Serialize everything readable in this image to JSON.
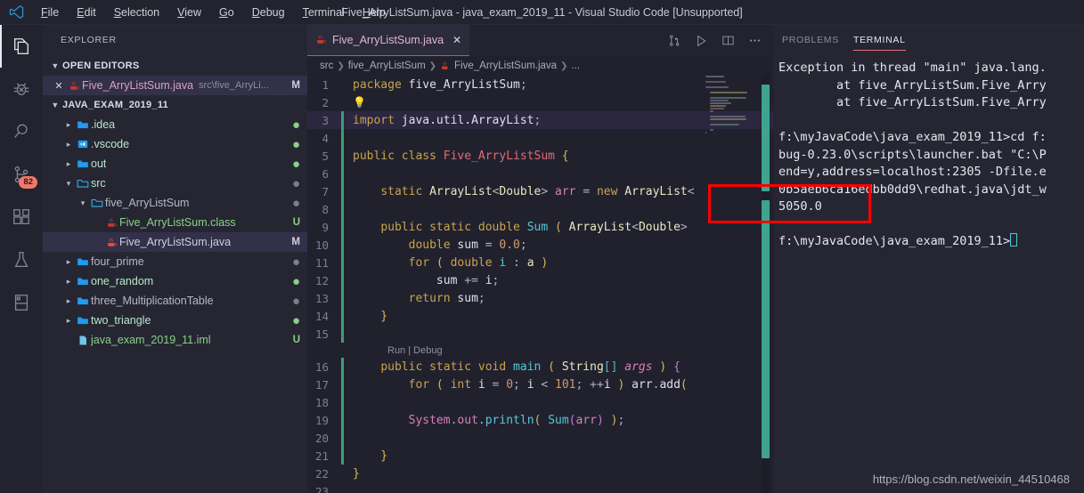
{
  "window": {
    "title": "Five_ArryListSum.java - java_exam_2019_11 - Visual Studio Code [Unsupported]",
    "logo_icon": "vscode-logo-icon"
  },
  "menubar": {
    "items": [
      {
        "label": "File"
      },
      {
        "label": "Edit"
      },
      {
        "label": "Selection"
      },
      {
        "label": "View"
      },
      {
        "label": "Go"
      },
      {
        "label": "Debug"
      },
      {
        "label": "Terminal"
      },
      {
        "label": "Help"
      }
    ]
  },
  "activitybar": {
    "items": [
      {
        "icon": "files-explorer-icon",
        "name": "explorer",
        "active": true,
        "badge": ""
      },
      {
        "icon": "debug-bug-icon",
        "name": "debug",
        "active": false,
        "badge": ""
      },
      {
        "icon": "search-icon",
        "name": "search",
        "active": false,
        "badge": ""
      },
      {
        "icon": "source-control-branch-icon",
        "name": "source-control",
        "active": false,
        "badge": "82"
      },
      {
        "icon": "extensions-blocks-icon",
        "name": "extensions",
        "active": false,
        "badge": ""
      },
      {
        "icon": "testing-flask-icon",
        "name": "testing",
        "active": false,
        "badge": ""
      },
      {
        "icon": "layout-panel-icon",
        "name": "layout",
        "active": false,
        "badge": ""
      }
    ]
  },
  "sidebar": {
    "title": "EXPLORER",
    "open_editors": {
      "label": "OPEN EDITORS",
      "items": [
        {
          "close_icon": "close-icon",
          "file_icon": "java-coffee-icon",
          "label": "Five_ArryListSum.java",
          "path": "src\\five_ArryLi...",
          "status": "M"
        }
      ]
    },
    "project": {
      "label": "JAVA_EXAM_2019_11",
      "tree": [
        {
          "arrow": "›",
          "icon": "folder-icon",
          "icon_color": "#1f9cf0",
          "label": ".idea",
          "indent": 1,
          "decor": "●",
          "decor_color": "#89d185",
          "label_color": "#b7e7c9"
        },
        {
          "arrow": "›",
          "icon": "vscode-folder-icon",
          "icon_color": "#1f9cf0",
          "label": ".vscode",
          "indent": 1,
          "decor": "●",
          "decor_color": "#89d185",
          "label_color": "#b7e7c9"
        },
        {
          "arrow": "›",
          "icon": "folder-icon",
          "icon_color": "#1f9cf0",
          "label": "out",
          "indent": 1,
          "decor": "●",
          "decor_color": "#89d185",
          "label_color": "#b7e7c9"
        },
        {
          "arrow": "∨",
          "icon": "folder-open-icon",
          "icon_color": "#2bb6f0",
          "label": "src",
          "indent": 1,
          "decor": "●",
          "decor_color": "#7d7d8d",
          "label_color": "#b7e7c9"
        },
        {
          "arrow": "∨",
          "icon": "folder-open-icon",
          "icon_color": "#2bb6f0",
          "label": "five_ArryListSum",
          "indent": 2,
          "decor": "●",
          "decor_color": "#7d7d8d",
          "label_color": "#b7b7c6"
        },
        {
          "arrow": "",
          "icon": "java-coffee-icon",
          "icon_color": "#c0392b",
          "label": "Five_ArryListSum.class",
          "indent": 3,
          "git": "U",
          "git_color": "#89d185",
          "label_color": "#89d185"
        },
        {
          "arrow": "",
          "icon": "java-coffee-icon",
          "icon_color": "#e74c3c",
          "label": "Five_ArryListSum.java",
          "indent": 3,
          "git": "M",
          "git_color": "#cfcfdb",
          "label_color": "#cfcfdb",
          "selected": true
        },
        {
          "arrow": "›",
          "icon": "folder-icon",
          "icon_color": "#1f9cf0",
          "label": "four_prime",
          "indent": 1,
          "decor": "●",
          "decor_color": "#7d7d8d",
          "label_color": "#b7b7c6"
        },
        {
          "arrow": "›",
          "icon": "folder-icon",
          "icon_color": "#1f9cf0",
          "label": "one_random",
          "indent": 1,
          "decor": "●",
          "decor_color": "#89d185",
          "label_color": "#b7e7c9"
        },
        {
          "arrow": "›",
          "icon": "folder-icon",
          "icon_color": "#1f9cf0",
          "label": "three_MultiplicationTable",
          "indent": 1,
          "decor": "●",
          "decor_color": "#7d7d8d",
          "label_color": "#b7b7c6"
        },
        {
          "arrow": "›",
          "icon": "folder-icon",
          "icon_color": "#1f9cf0",
          "label": "two_triangle",
          "indent": 1,
          "decor": "●",
          "decor_color": "#89d185",
          "label_color": "#b7e7c9"
        },
        {
          "arrow": "",
          "icon": "file-icon",
          "icon_color": "#6fc3e8",
          "label": "java_exam_2019_11.iml",
          "indent": 1,
          "git": "U",
          "git_color": "#89d185",
          "label_color": "#89d185"
        }
      ]
    }
  },
  "editor": {
    "tab": {
      "icon": "java-coffee-icon",
      "label": "Five_ArryListSum.java",
      "close_icon": "close-icon"
    },
    "actions": [
      {
        "icon": "split-compare-icon",
        "name": "source-control-compare"
      },
      {
        "icon": "run-play-icon",
        "name": "run-file"
      },
      {
        "icon": "split-editor-icon",
        "name": "split-editor"
      },
      {
        "icon": "more-ellipsis-icon",
        "name": "more-actions"
      }
    ],
    "breadcrumb": [
      "src",
      "five_ArryListSum",
      "Five_ArryListSum.java",
      "..."
    ],
    "codelens": {
      "run": "Run",
      "sep": "|",
      "debug": "Debug"
    },
    "lines": [
      {
        "n": "1",
        "tokens": [
          {
            "t": "package ",
            "c": "k"
          },
          {
            "t": "five_ArryListSum",
            "c": "pl"
          },
          {
            "t": ";",
            "c": "op"
          }
        ]
      },
      {
        "n": "2",
        "bulb": true,
        "tokens": []
      },
      {
        "n": "3",
        "current": true,
        "change": "#3f9c74",
        "tokens": [
          {
            "t": "import ",
            "c": "k"
          },
          {
            "t": "java.util.ArrayList",
            "c": "pl"
          },
          {
            "t": ";",
            "c": "op"
          }
        ]
      },
      {
        "n": "4",
        "change": "#3f9c74",
        "tokens": []
      },
      {
        "n": "5",
        "change": "#3f9c74",
        "tokens": [
          {
            "t": "public class ",
            "c": "k"
          },
          {
            "t": "Five_ArryListSum",
            "c": "cls"
          },
          {
            "t": " {",
            "c": "brk1"
          }
        ]
      },
      {
        "n": "6",
        "change": "#3f9c74",
        "tokens": []
      },
      {
        "n": "7",
        "change": "#3f9c74",
        "tokens": [
          {
            "t": "    ",
            "c": "op"
          },
          {
            "t": "static ",
            "c": "k"
          },
          {
            "t": "ArrayList",
            "c": "ty"
          },
          {
            "t": "<",
            "c": "op"
          },
          {
            "t": "Double",
            "c": "ty"
          },
          {
            "t": "> ",
            "c": "op"
          },
          {
            "t": "arr",
            "c": "var"
          },
          {
            "t": " = ",
            "c": "op"
          },
          {
            "t": "new ",
            "c": "k"
          },
          {
            "t": "ArrayList",
            "c": "ty"
          },
          {
            "t": "<",
            "c": "op"
          }
        ]
      },
      {
        "n": "8",
        "change": "#3f9c74",
        "tokens": []
      },
      {
        "n": "9",
        "change": "#3f9c74",
        "tokens": [
          {
            "t": "    ",
            "c": "op"
          },
          {
            "t": "public static double ",
            "c": "k"
          },
          {
            "t": "Sum",
            "c": "fn"
          },
          {
            "t": " ( ",
            "c": "brk1"
          },
          {
            "t": "ArrayList",
            "c": "ty"
          },
          {
            "t": "<",
            "c": "op"
          },
          {
            "t": "Double",
            "c": "ty"
          },
          {
            "t": ">",
            "c": "op"
          }
        ]
      },
      {
        "n": "10",
        "change": "#3f9c74",
        "tokens": [
          {
            "t": "        ",
            "c": "op"
          },
          {
            "t": "double ",
            "c": "k"
          },
          {
            "t": "sum",
            "c": "pl"
          },
          {
            "t": " = ",
            "c": "op"
          },
          {
            "t": "0.0",
            "c": "num"
          },
          {
            "t": ";",
            "c": "op"
          }
        ]
      },
      {
        "n": "11",
        "change": "#3f9c74",
        "tokens": [
          {
            "t": "        ",
            "c": "op"
          },
          {
            "t": "for",
            "c": "k"
          },
          {
            "t": " ( ",
            "c": "brk1"
          },
          {
            "t": "double ",
            "c": "k"
          },
          {
            "t": "i",
            "c": "fn"
          },
          {
            "t": " : ",
            "c": "op"
          },
          {
            "t": "a",
            "c": "ty"
          },
          {
            "t": " )",
            "c": "brk1"
          }
        ]
      },
      {
        "n": "12",
        "change": "#3f9c74",
        "tokens": [
          {
            "t": "            ",
            "c": "op"
          },
          {
            "t": "sum",
            "c": "pl"
          },
          {
            "t": " += ",
            "c": "op"
          },
          {
            "t": "i",
            "c": "pl"
          },
          {
            "t": ";",
            "c": "op"
          }
        ]
      },
      {
        "n": "13",
        "change": "#3f9c74",
        "tokens": [
          {
            "t": "        ",
            "c": "op"
          },
          {
            "t": "return ",
            "c": "k"
          },
          {
            "t": "sum",
            "c": "pl"
          },
          {
            "t": ";",
            "c": "op"
          }
        ]
      },
      {
        "n": "14",
        "change": "#3f9c74",
        "tokens": [
          {
            "t": "    }",
            "c": "brk1"
          }
        ]
      },
      {
        "n": "15",
        "change": "#3f9c74",
        "tokens": []
      },
      {
        "n": "16",
        "change": "#3f9c74",
        "lens": true,
        "tokens": [
          {
            "t": "    ",
            "c": "op"
          },
          {
            "t": "public static void ",
            "c": "k"
          },
          {
            "t": "main",
            "c": "fn"
          },
          {
            "t": " ( ",
            "c": "brk1"
          },
          {
            "t": "String",
            "c": "ty"
          },
          {
            "t": "[] ",
            "c": "brk3"
          },
          {
            "t": "args",
            "c": "prm"
          },
          {
            "t": " ) ",
            "c": "brk1"
          },
          {
            "t": "{",
            "c": "brk2"
          }
        ]
      },
      {
        "n": "17",
        "change": "#3f9c74",
        "tokens": [
          {
            "t": "        ",
            "c": "op"
          },
          {
            "t": "for",
            "c": "k"
          },
          {
            "t": " ( ",
            "c": "brk1"
          },
          {
            "t": "int ",
            "c": "k"
          },
          {
            "t": "i",
            "c": "pl"
          },
          {
            "t": " = ",
            "c": "op"
          },
          {
            "t": "0",
            "c": "num"
          },
          {
            "t": "; ",
            "c": "op"
          },
          {
            "t": "i",
            "c": "pl"
          },
          {
            "t": " < ",
            "c": "op"
          },
          {
            "t": "101",
            "c": "num"
          },
          {
            "t": "; ",
            "c": "op"
          },
          {
            "t": "++",
            "c": "op"
          },
          {
            "t": "i",
            "c": "pl"
          },
          {
            "t": " ) ",
            "c": "brk1"
          },
          {
            "t": "arr",
            "c": "pl"
          },
          {
            "t": ".",
            "c": "op"
          },
          {
            "t": "add",
            "c": "pl"
          },
          {
            "t": "(",
            "c": "brk1"
          }
        ]
      },
      {
        "n": "18",
        "change": "#3f9c74",
        "tokens": []
      },
      {
        "n": "19",
        "change": "#3f9c74",
        "tokens": [
          {
            "t": "        ",
            "c": "op"
          },
          {
            "t": "System",
            "c": "var"
          },
          {
            "t": ".",
            "c": "op"
          },
          {
            "t": "out",
            "c": "var"
          },
          {
            "t": ".",
            "c": "op"
          },
          {
            "t": "println",
            "c": "fn"
          },
          {
            "t": "( ",
            "c": "brk1"
          },
          {
            "t": "Sum",
            "c": "fn"
          },
          {
            "t": "(",
            "c": "brk2"
          },
          {
            "t": "arr",
            "c": "var"
          },
          {
            "t": ") ",
            "c": "brk2"
          },
          {
            "t": ")",
            "c": "brk1"
          },
          {
            "t": ";",
            "c": "op"
          }
        ]
      },
      {
        "n": "20",
        "change": "#3f9c74",
        "tokens": []
      },
      {
        "n": "21",
        "change": "#3f9c74",
        "tokens": [
          {
            "t": "    }",
            "c": "brk1"
          }
        ]
      },
      {
        "n": "22",
        "tokens": [
          {
            "t": "}",
            "c": "brk1"
          }
        ]
      },
      {
        "n": "23",
        "tokens": []
      }
    ]
  },
  "panel": {
    "tabs": [
      {
        "label": "PROBLEMS",
        "active": false
      },
      {
        "label": "TERMINAL",
        "active": true
      }
    ],
    "terminal_lines": [
      "Exception in thread \"main\" java.lang.",
      "        at five_ArryListSum.Five_Arry",
      "        at five_ArryListSum.Five_Arry",
      "",
      "f:\\myJavaCode\\java_exam_2019_11>cd f:",
      "bug-0.23.0\\scripts\\launcher.bat \"C:\\P",
      "end=y,address=localhost:2305 -Dfile.e",
      "0b5aeb6ca16edbb0dd9\\redhat.java\\jdt_w",
      "5050.0",
      "",
      "f:\\myJavaCode\\java_exam_2019_11>"
    ]
  },
  "watermark": "https://blog.csdn.net/weixin_44510468",
  "colors": {
    "accent_red": "#fb0000",
    "badge": "#f4776a",
    "tab_underline": "#b0529f",
    "terminal_tab_underline": "#e06c75",
    "scrollbar": "#3fa38f"
  }
}
